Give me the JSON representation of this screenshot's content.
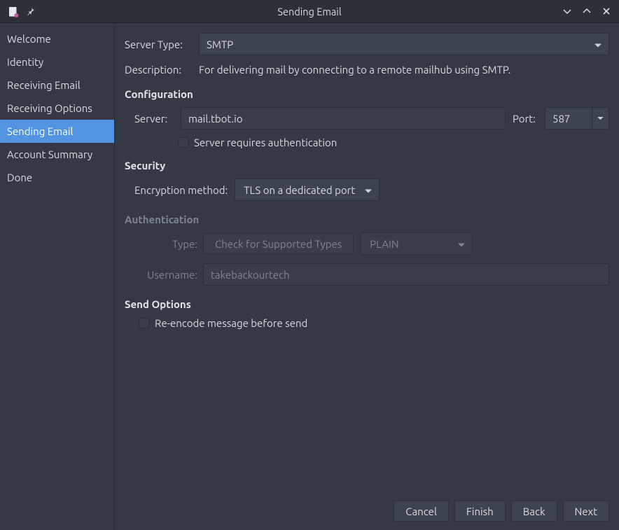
{
  "window": {
    "title": "Sending Email"
  },
  "sidebar": {
    "items": [
      {
        "label": "Welcome",
        "selected": false
      },
      {
        "label": "Identity",
        "selected": false
      },
      {
        "label": "Receiving Email",
        "selected": false
      },
      {
        "label": "Receiving Options",
        "selected": false
      },
      {
        "label": "Sending Email",
        "selected": true
      },
      {
        "label": "Account Summary",
        "selected": false
      },
      {
        "label": "Done",
        "selected": false
      }
    ]
  },
  "main": {
    "server_type_label": "Server Type:",
    "server_type_value": "SMTP",
    "description_label": "Description:",
    "description_text": "For delivering mail by connecting to a remote mailhub using SMTP.",
    "configuration_heading": "Configuration",
    "server_label": "Server:",
    "server_value": "mail.tbot.io",
    "port_label": "Port:",
    "port_value": "587",
    "requires_auth_label": "Server requires authentication",
    "requires_auth_checked": false,
    "security_heading": "Security",
    "encryption_label": "Encryption method:",
    "encryption_value": "TLS on a dedicated port",
    "authentication_heading": "Authentication",
    "auth_type_label": "Type:",
    "auth_check_btn": "Check for Supported Types",
    "auth_type_value": "PLAIN",
    "username_label": "Username:",
    "username_value": "takebackourtech",
    "send_options_heading": "Send Options",
    "reencode_label": "Re-encode message before send",
    "reencode_checked": false
  },
  "footer": {
    "cancel": "Cancel",
    "finish": "Finish",
    "back": "Back",
    "next": "Next"
  }
}
